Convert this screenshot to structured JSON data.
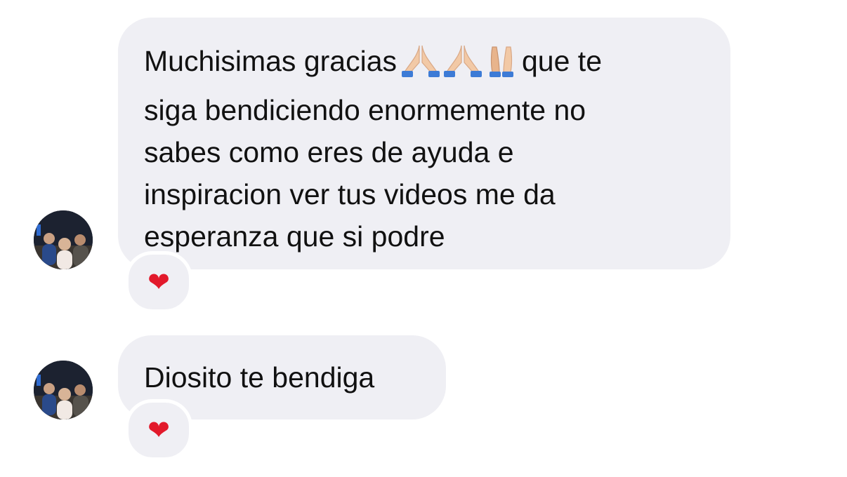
{
  "messages": [
    {
      "lines": [
        "Muchisimas gracias",
        "que te",
        "siga bendiciendo enormemente no",
        "sabes como eres de ayuda e",
        "inspiracion ver tus videos me da",
        "esperanza que si podre"
      ],
      "emoji_icons": [
        "folded-hands-icon",
        "folded-hands-icon",
        "raised-hands-icon"
      ],
      "reaction": "❤"
    },
    {
      "lines": [
        "Diosito te bendiga"
      ],
      "reaction": "❤"
    }
  ],
  "colors": {
    "bubble": "#efeff4",
    "text": "#111111",
    "heart": "#e2192b",
    "skin": "#f2c9a6"
  }
}
